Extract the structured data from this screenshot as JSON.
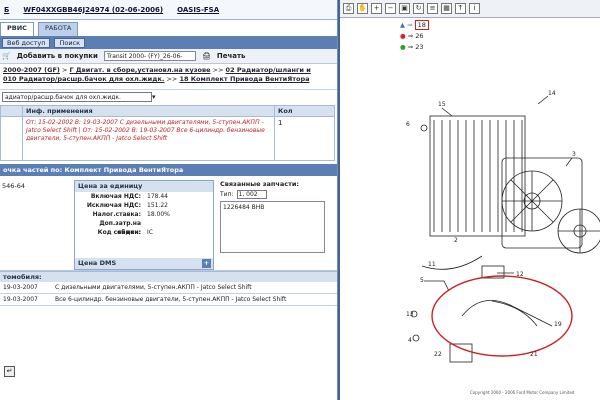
{
  "header": {
    "code_left": "Б",
    "vin": "WF04XXGBB46J24974 (02-06-2006)",
    "system": "OASIS-FSA"
  },
  "tabs": [
    "РВИС",
    "РАБОТА"
  ],
  "toolbar1": {
    "access": "Веб доступ",
    "search": "Поиск"
  },
  "toolbar2": {
    "add_label": "Добавить в покупки",
    "model_select": "Transit 2000- (FY)_26-06-",
    "print_label": "Печать"
  },
  "breadcrumb": {
    "part1": "2000-2007 (GF)",
    "sep1": ">",
    "part2": "Г Двигат. в сборе,установл.на кузове",
    "sep2": ">>",
    "part3": "02 Радиатор/шланги и",
    "part4": "010 Радиатор/расшр.бачок для охл.жидк.",
    "sep3": ">>",
    "part5": "18 Комплект Привода ВентиЯтора"
  },
  "dropdown": {
    "value": "адиатор/расшр.бачок для охл.жидк."
  },
  "app_table": {
    "headers": [
      "Инф. применения",
      "Кол"
    ],
    "text": "От: 15-02-2002 В: 19-03-2007 С дизельными двигателями, 5-ступен.АКПП - Jatco Select Shift | От: 15-02-2002 В: 19-03-2007 Все 6-цилиндр. бензиновые двигатели, 5-ступен.АКПП - Jatco Select Shift",
    "qty": "1"
  },
  "info": {
    "header": "очка частей по: Комплект Привода ВентиЯтора",
    "part_number": "546-64",
    "price_header": "Цена за единицу",
    "rows": [
      {
        "k": "Включая НДС:",
        "v": "178.44"
      },
      {
        "k": "Исключая НДС:",
        "v": "151.22"
      },
      {
        "k": "Налог.ставка:",
        "v": "18.00%"
      },
      {
        "k": "Доп.затр.на обмен:",
        "v": ""
      },
      {
        "k": "Код скидки:",
        "v": "IC"
      }
    ],
    "dms_label": "Цена DMS",
    "related_header": "Связанные запчасти:",
    "type_label": "Тип:",
    "type_value": "1, 002",
    "related_item": "1226484 ВНВ"
  },
  "cars": {
    "header": "томобиля:",
    "rows": [
      {
        "date": "19-03-2007",
        "text": "С дизельными двигателями, 5-ступен.АКПП - Jatco Select Shift"
      },
      {
        "date": "19-03-2007",
        "text": "Все 6-цилиндр. бензиновые двигатели, 5-ступен.АКПП - Jatco Select Shift"
      }
    ]
  },
  "diagram": {
    "legend": [
      "18",
      "26",
      "23"
    ],
    "labels": [
      "15",
      "14",
      "6",
      "3",
      "2",
      "12",
      "11",
      "13",
      "19",
      "21",
      "22",
      "5",
      "4"
    ],
    "copyright": "Copyright 2000 - 2006 Ford Motor Company Limited"
  }
}
